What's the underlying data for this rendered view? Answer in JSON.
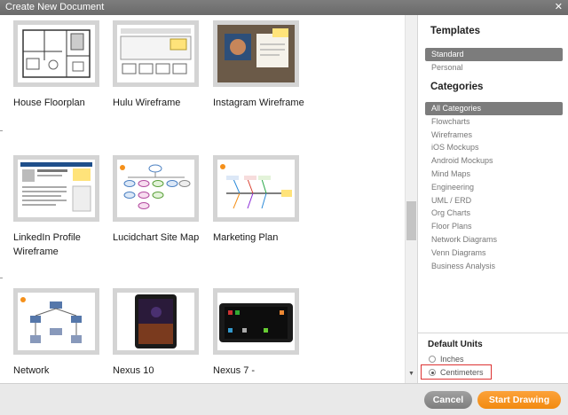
{
  "window": {
    "title": "Create New Document"
  },
  "templates": [
    {
      "label": "House Floorplan"
    },
    {
      "label": "Hulu Wireframe"
    },
    {
      "label": "Instagram Wireframe"
    },
    {
      "label": "LinkedIn Profile Wireframe"
    },
    {
      "label": "Lucidchart Site Map"
    },
    {
      "label": "Marketing Plan"
    },
    {
      "label": "Network"
    },
    {
      "label": "Nexus 10"
    },
    {
      "label": "Nexus 7 -"
    }
  ],
  "sidebar": {
    "templates_title": "Templates",
    "template_options": [
      "Standard",
      "Personal"
    ],
    "selected_template": "Standard",
    "categories_title": "Categories",
    "categories": [
      "All Categories",
      "Flowcharts",
      "Wireframes",
      "iOS Mockups",
      "Android Mockups",
      "Mind Maps",
      "Engineering",
      "UML / ERD",
      "Org Charts",
      "Floor Plans",
      "Network Diagrams",
      "Venn Diagrams",
      "Business Analysis"
    ],
    "selected_category": "All Categories",
    "units_title": "Default Units",
    "units": [
      "Inches",
      "Centimeters"
    ],
    "selected_unit": "Centimeters"
  },
  "footer": {
    "cancel_label": "Cancel",
    "start_label": "Start Drawing"
  },
  "colors": {
    "accent": "#f5901a",
    "selected_bg": "#7c7c7c",
    "highlight_box": "#dd3333"
  }
}
